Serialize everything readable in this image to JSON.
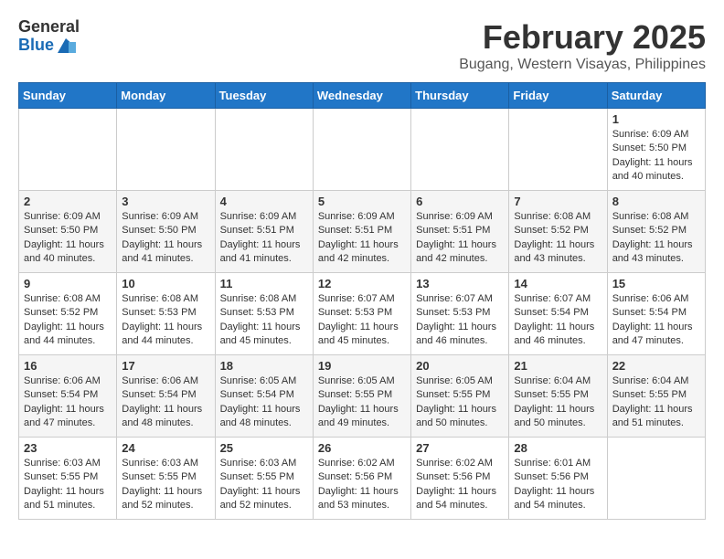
{
  "header": {
    "logo_general": "General",
    "logo_blue": "Blue",
    "month": "February 2025",
    "location": "Bugang, Western Visayas, Philippines"
  },
  "weekdays": [
    "Sunday",
    "Monday",
    "Tuesday",
    "Wednesday",
    "Thursday",
    "Friday",
    "Saturday"
  ],
  "weeks": [
    [
      {
        "day": "",
        "sunrise": "",
        "sunset": "",
        "daylight": ""
      },
      {
        "day": "",
        "sunrise": "",
        "sunset": "",
        "daylight": ""
      },
      {
        "day": "",
        "sunrise": "",
        "sunset": "",
        "daylight": ""
      },
      {
        "day": "",
        "sunrise": "",
        "sunset": "",
        "daylight": ""
      },
      {
        "day": "",
        "sunrise": "",
        "sunset": "",
        "daylight": ""
      },
      {
        "day": "",
        "sunrise": "",
        "sunset": "",
        "daylight": ""
      },
      {
        "day": "1",
        "sunrise": "6:09 AM",
        "sunset": "5:50 PM",
        "daylight": "11 hours and 40 minutes."
      }
    ],
    [
      {
        "day": "2",
        "sunrise": "6:09 AM",
        "sunset": "5:50 PM",
        "daylight": "11 hours and 40 minutes."
      },
      {
        "day": "3",
        "sunrise": "6:09 AM",
        "sunset": "5:50 PM",
        "daylight": "11 hours and 41 minutes."
      },
      {
        "day": "4",
        "sunrise": "6:09 AM",
        "sunset": "5:51 PM",
        "daylight": "11 hours and 41 minutes."
      },
      {
        "day": "5",
        "sunrise": "6:09 AM",
        "sunset": "5:51 PM",
        "daylight": "11 hours and 42 minutes."
      },
      {
        "day": "6",
        "sunrise": "6:09 AM",
        "sunset": "5:51 PM",
        "daylight": "11 hours and 42 minutes."
      },
      {
        "day": "7",
        "sunrise": "6:08 AM",
        "sunset": "5:52 PM",
        "daylight": "11 hours and 43 minutes."
      },
      {
        "day": "8",
        "sunrise": "6:08 AM",
        "sunset": "5:52 PM",
        "daylight": "11 hours and 43 minutes."
      }
    ],
    [
      {
        "day": "9",
        "sunrise": "6:08 AM",
        "sunset": "5:52 PM",
        "daylight": "11 hours and 44 minutes."
      },
      {
        "day": "10",
        "sunrise": "6:08 AM",
        "sunset": "5:53 PM",
        "daylight": "11 hours and 44 minutes."
      },
      {
        "day": "11",
        "sunrise": "6:08 AM",
        "sunset": "5:53 PM",
        "daylight": "11 hours and 45 minutes."
      },
      {
        "day": "12",
        "sunrise": "6:07 AM",
        "sunset": "5:53 PM",
        "daylight": "11 hours and 45 minutes."
      },
      {
        "day": "13",
        "sunrise": "6:07 AM",
        "sunset": "5:53 PM",
        "daylight": "11 hours and 46 minutes."
      },
      {
        "day": "14",
        "sunrise": "6:07 AM",
        "sunset": "5:54 PM",
        "daylight": "11 hours and 46 minutes."
      },
      {
        "day": "15",
        "sunrise": "6:06 AM",
        "sunset": "5:54 PM",
        "daylight": "11 hours and 47 minutes."
      }
    ],
    [
      {
        "day": "16",
        "sunrise": "6:06 AM",
        "sunset": "5:54 PM",
        "daylight": "11 hours and 47 minutes."
      },
      {
        "day": "17",
        "sunrise": "6:06 AM",
        "sunset": "5:54 PM",
        "daylight": "11 hours and 48 minutes."
      },
      {
        "day": "18",
        "sunrise": "6:05 AM",
        "sunset": "5:54 PM",
        "daylight": "11 hours and 48 minutes."
      },
      {
        "day": "19",
        "sunrise": "6:05 AM",
        "sunset": "5:55 PM",
        "daylight": "11 hours and 49 minutes."
      },
      {
        "day": "20",
        "sunrise": "6:05 AM",
        "sunset": "5:55 PM",
        "daylight": "11 hours and 50 minutes."
      },
      {
        "day": "21",
        "sunrise": "6:04 AM",
        "sunset": "5:55 PM",
        "daylight": "11 hours and 50 minutes."
      },
      {
        "day": "22",
        "sunrise": "6:04 AM",
        "sunset": "5:55 PM",
        "daylight": "11 hours and 51 minutes."
      }
    ],
    [
      {
        "day": "23",
        "sunrise": "6:03 AM",
        "sunset": "5:55 PM",
        "daylight": "11 hours and 51 minutes."
      },
      {
        "day": "24",
        "sunrise": "6:03 AM",
        "sunset": "5:55 PM",
        "daylight": "11 hours and 52 minutes."
      },
      {
        "day": "25",
        "sunrise": "6:03 AM",
        "sunset": "5:55 PM",
        "daylight": "11 hours and 52 minutes."
      },
      {
        "day": "26",
        "sunrise": "6:02 AM",
        "sunset": "5:56 PM",
        "daylight": "11 hours and 53 minutes."
      },
      {
        "day": "27",
        "sunrise": "6:02 AM",
        "sunset": "5:56 PM",
        "daylight": "11 hours and 54 minutes."
      },
      {
        "day": "28",
        "sunrise": "6:01 AM",
        "sunset": "5:56 PM",
        "daylight": "11 hours and 54 minutes."
      },
      {
        "day": "",
        "sunrise": "",
        "sunset": "",
        "daylight": ""
      }
    ]
  ]
}
